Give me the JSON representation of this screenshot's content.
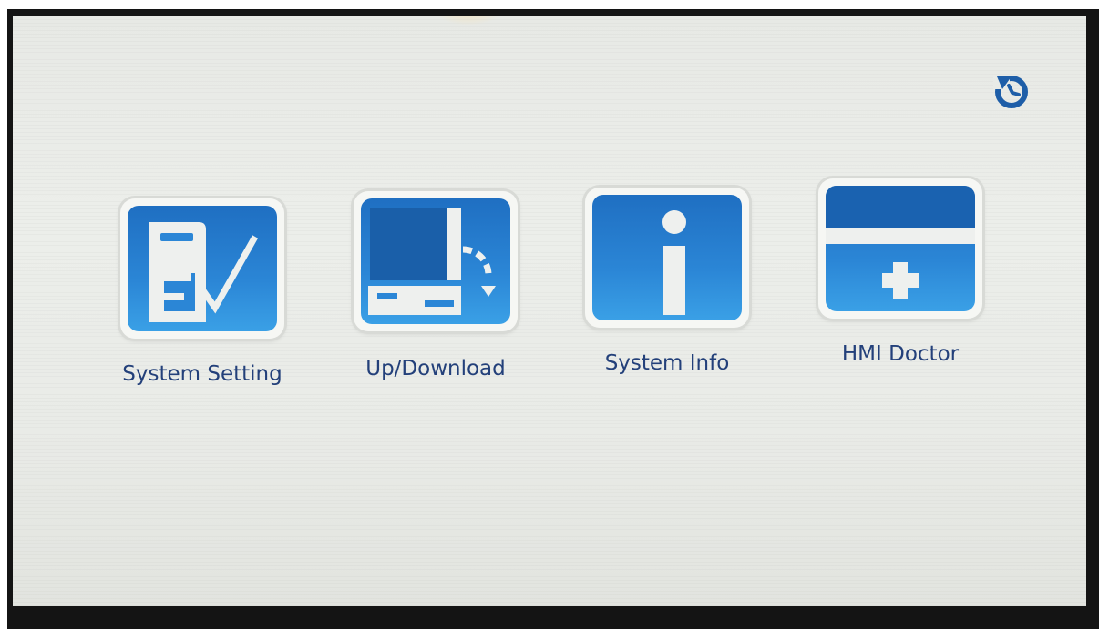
{
  "screen": {
    "menu": [
      {
        "label": "System Setting",
        "icon": "system-setting-icon"
      },
      {
        "label": "Up/Download",
        "icon": "up-download-icon"
      },
      {
        "label": "System Info",
        "icon": "info-icon"
      },
      {
        "label": "HMI Doctor",
        "icon": "hmi-doctor-icon"
      }
    ],
    "reset_icon": "restart-icon",
    "colors": {
      "icon_blue": "#2b86d6",
      "label_text": "#23407a",
      "icon_white": "#eef0ee"
    }
  }
}
